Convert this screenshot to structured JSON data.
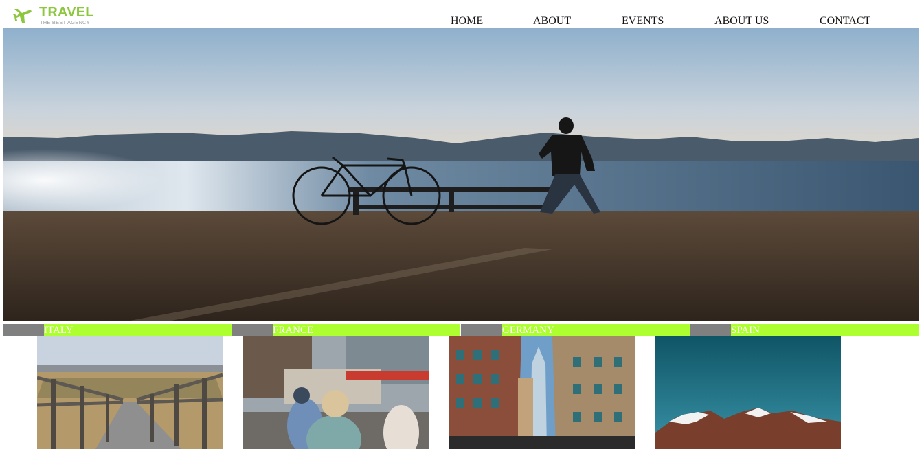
{
  "brand": {
    "name": "TRAVEL",
    "tagline": "THE BEST AGENCY",
    "accent_color": "#8dc63f",
    "icon": "airplane-icon"
  },
  "nav": {
    "items": [
      {
        "label": "HOME"
      },
      {
        "label": "ABOUT"
      },
      {
        "label": "EVENTS"
      },
      {
        "label": "ABOUT US"
      },
      {
        "label": "CONTACT"
      }
    ]
  },
  "hero": {
    "image": "man-with-bicycle-at-lakeside-photo"
  },
  "countries": [
    {
      "label": "ITALY",
      "image": "wooden-boardwalk-photo"
    },
    {
      "label": "FRANCE",
      "image": "busy-street-crowd-photo"
    },
    {
      "label": "GERMANY",
      "image": "city-skyscrapers-photo"
    },
    {
      "label": "SPAIN",
      "image": "snowy-mountain-photo"
    }
  ],
  "colors": {
    "bar_green": "#adff2f",
    "bar_grey": "#808080",
    "label_text": "#ffffff"
  }
}
